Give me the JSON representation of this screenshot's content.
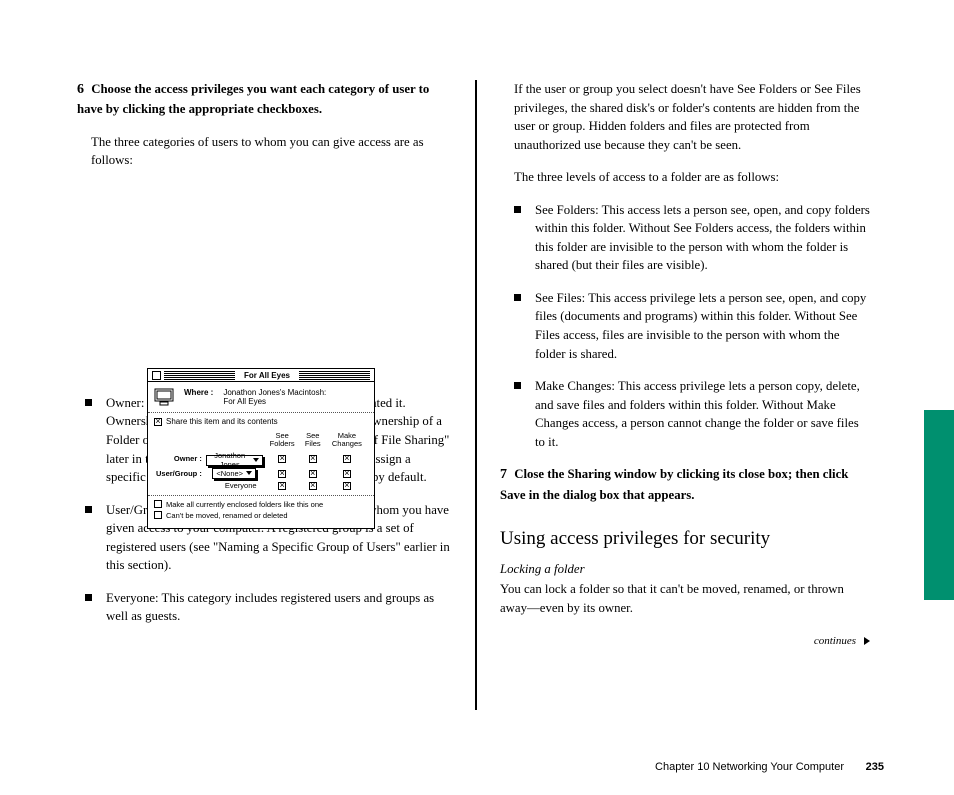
{
  "left": {
    "intro1_pre": "6",
    "intro1": "Choose the access privileges you want each category of user to have by clicking the appropriate checkboxes.",
    "intro2": "The three categories of users to whom you can give access are as follows:",
    "bullets": [
      "Owner: The owner of a folder is the person who created it. Ownership can be given away (see \"Giving Away Ownership of a Folder or Disk\" in the section \"Advanced Features of File Sharing\" later in this chapter). If you share a folder but don't assign a specific owner, you remain the owner of that folder by default.",
      "User/Group: A registered user is a single person to whom you have given access to your computer. A registered group is a set of registered users (see \"Naming a Specific Group of Users\" earlier in this section).",
      "Everyone: This category includes registered users and groups as well as guests."
    ]
  },
  "right": {
    "p1": "If the user or group you select doesn't have See Folders or See Files privileges, the shared disk's or folder's contents are hidden from the user or group. Hidden folders and files are protected from unauthorized use because they can't be seen.",
    "p2": "The three levels of access to a folder are as follows:",
    "bullets": [
      "See Folders: This access lets a person see, open, and copy folders within this folder. Without See Folders access, the folders within this folder are invisible to the person with whom the folder is shared (but their files are visible).",
      "See Files: This access privilege lets a person see, open, and copy files (documents and programs) within this folder. Without See Files access, files are invisible to the person with whom the folder is shared.",
      "Make Changes: This access privilege lets a person copy, delete, and save files and folders within this folder. Without Make Changes access, a person cannot change the folder or save files to it."
    ],
    "close_pre": "7",
    "close": "Close the Sharing window by clicking its close box; then click Save in the dialog box that appears.",
    "head": "Using access privileges for security",
    "sec_sub": "Locking a folder",
    "sec_body": "You can lock a folder so that it can't be moved, renamed, or thrown away—even by its owner.",
    "continued": "continues",
    "triangle": "."
  },
  "win": {
    "title": "For All Eyes",
    "where_label": "Where :",
    "where_val1": "Jonathon Jones's Macintosh:",
    "where_val2": "For All Eyes",
    "share_label": "Share this item and its contents",
    "col1": "See Folders",
    "col2": "See Files",
    "col3": "Make Changes",
    "row_owner": "Owner :",
    "row_owner_val": "Jonathon Jones",
    "row_ug": "User/Group :",
    "row_ug_val": "<None>",
    "row_ev": "Everyone",
    "opt1": "Make all currently enclosed folders like this one",
    "opt2": "Can't be moved, renamed or deleted"
  },
  "footer": {
    "chapter": "Chapter 10   Networking Your Computer",
    "page": "235"
  }
}
